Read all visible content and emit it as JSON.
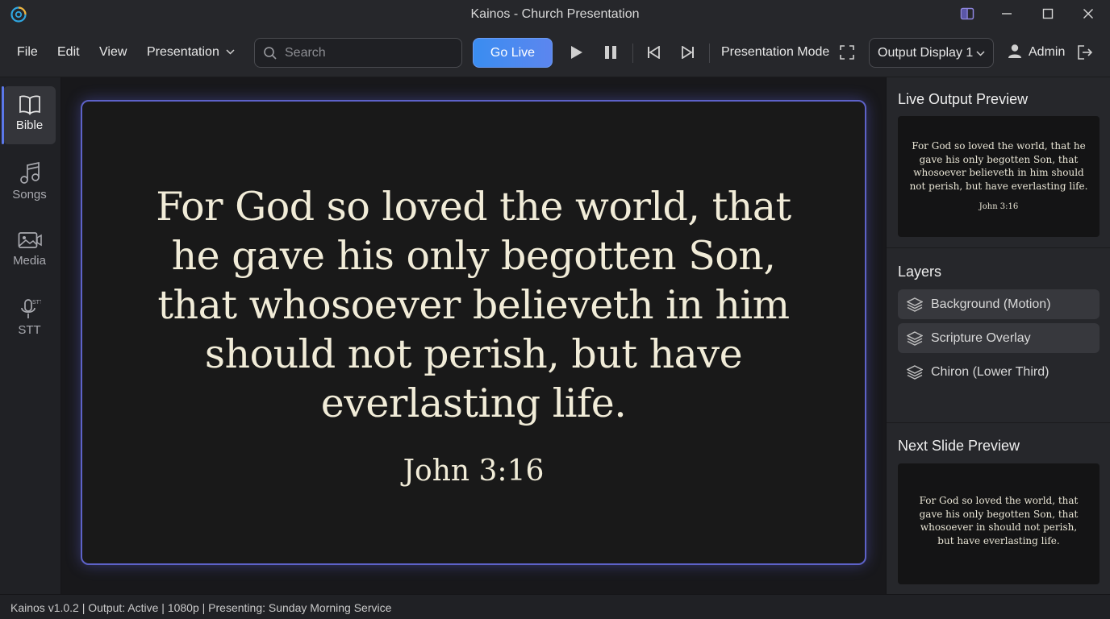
{
  "window": {
    "title": "Kainos - Church Presentation"
  },
  "menu": {
    "file": "File",
    "edit": "Edit",
    "view": "View",
    "presentation": "Presentation"
  },
  "search": {
    "placeholder": "Search"
  },
  "controls": {
    "go_live": "Go Live",
    "presentation_mode": "Presentation Mode",
    "output_display": "Output Display 1",
    "user": "Admin"
  },
  "nav": {
    "items": [
      {
        "label": "Bible",
        "icon": "book-icon",
        "active": true
      },
      {
        "label": "Songs",
        "icon": "music-note-icon",
        "active": false
      },
      {
        "label": "Media",
        "icon": "image-video-icon",
        "active": false
      },
      {
        "label": "STT",
        "icon": "microphone-stt-icon",
        "active": false
      }
    ]
  },
  "slide": {
    "lines": [
      "For God so loved the world, that",
      "he gave his only begotten Son,",
      "that whosoever believeth in him",
      "should not perish, but have",
      "everlasting life."
    ],
    "reference": "John 3:16"
  },
  "live_preview": {
    "title": "Live Output Preview",
    "lines": [
      "For God so loved the world, that he",
      "gave his only begotten Son, that",
      "whosoever believeth in him should",
      "not perish, but have everlasting life."
    ],
    "reference": "John 3:16"
  },
  "layers": {
    "title": "Layers",
    "items": [
      {
        "label": "Background (Motion)",
        "highlighted": true
      },
      {
        "label": "Scripture Overlay",
        "highlighted": true
      },
      {
        "label": "Chiron (Lower Third)",
        "highlighted": false
      }
    ]
  },
  "next_preview": {
    "title": "Next Slide Preview",
    "lines": [
      "For God so loved the world, that",
      "gave his only begotten Son, that",
      "whosoever in should not perish,",
      "but have everlasting life."
    ]
  },
  "status": {
    "text": "Kainos v1.0.2 | Output: Active | 1080p | Presenting: Sunday Morning Service"
  },
  "colors": {
    "accent": "#3a8df0",
    "slide_border": "#5d62c8",
    "scripture_text": "#f1ecd8"
  }
}
